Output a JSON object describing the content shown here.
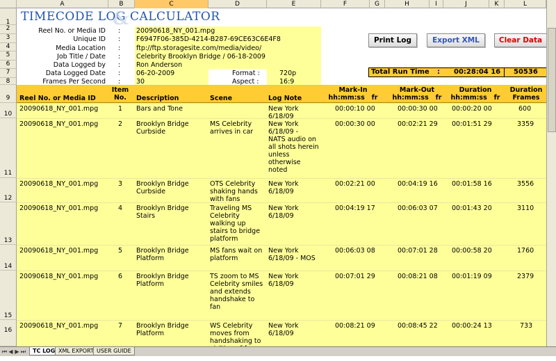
{
  "columns": [
    "A",
    "B",
    "C",
    "D",
    "E",
    "F",
    "G",
    "H",
    "I",
    "J",
    "K",
    "L"
  ],
  "selected_column": "C",
  "title": "TIMECODE LOG CALCULATOR",
  "title_glyph": "&",
  "meta": [
    {
      "label": "Reel No. or Media ID",
      "sep": ":",
      "value": "20090618_NY_001.mpg"
    },
    {
      "label": "Unique ID",
      "sep": ":",
      "value": "F6947F06-385D-4214-B287-69CE63C6E4F8"
    },
    {
      "label": "Media Location",
      "sep": ":",
      "value": "ftp://ftp.storagesite.com/media/video/"
    },
    {
      "label": "Job Title / Date",
      "sep": ":",
      "value": "Celebrity Brooklyn Bridge / 06-18-2009"
    },
    {
      "label": "Data Logged by",
      "sep": ":",
      "value": "Ron Anderson"
    },
    {
      "label": "Data Logged Date",
      "sep": ":",
      "value": "06-20-2009"
    },
    {
      "label": "Frames Per Second",
      "sep": ":",
      "value": "30"
    }
  ],
  "format_label": "Format :",
  "format_value": "720p",
  "aspect_label": "Aspect :",
  "aspect_value": "16:9",
  "buttons": {
    "print": "Print Log",
    "export": "Export XML",
    "clear": "Clear Data"
  },
  "total": {
    "label": "Total Run Time",
    "sep": ":",
    "time": "00:28:04 16",
    "frames": "50536"
  },
  "headers": {
    "reel": "Reel No. or Media ID",
    "item": "Item\nNo.",
    "desc": "Description",
    "scene": "Scene",
    "note": "Log Note",
    "markin": "Mark-In\nhh:mm:ss   fr",
    "markout": "Mark-Out\nhh:mm:ss   fr",
    "duration": "Duration\nhh:mm:ss   fr",
    "durframes": "Duration\nFrames"
  },
  "row_numbers": [
    "1",
    "2",
    "3",
    "4",
    "5",
    "6",
    "7",
    "8",
    "9",
    "10",
    "11",
    "12",
    "13",
    "14",
    "15",
    "16"
  ],
  "rows": [
    {
      "reel": "20090618_NY_001.mpg",
      "item": "1",
      "desc": "Bars and Tone",
      "scene": "",
      "note": "New York\n6/18/09",
      "in": "00:00:10 00",
      "out": "00:00:30 00",
      "dur": "00:00:20 00",
      "frames": "600"
    },
    {
      "reel": "20090618_NY_001.mpg",
      "item": "2",
      "desc": "Brooklyn Bridge\nCurbside",
      "scene": "MS Celebrity\narrives in car",
      "note": "New York\n6/18/09 -\nNATS audio on\nall shots herein\nunless\notherwise\nnoted",
      "in": "00:00:30 00",
      "out": "00:02:21 29",
      "dur": "00:01:51 29",
      "frames": "3359"
    },
    {
      "reel": "20090618_NY_001.mpg",
      "item": "3",
      "desc": "Brooklyn Bridge\nCurbside",
      "scene": "OTS Celebrity\nshaking hands\nwith fans",
      "note": "New York\n6/18/09",
      "in": "00:02:21 00",
      "out": "00:04:19 16",
      "dur": "00:01:58 16",
      "frames": "3556"
    },
    {
      "reel": "20090618_NY_001.mpg",
      "item": "4",
      "desc": "Brooklyn Bridge\nStairs",
      "scene": "Traveling MS\nCelebrity\nwalking up\nstairs to bridge\nplatform",
      "note": "New York\n6/18/09",
      "in": "00:04:19 17",
      "out": "00:06:03 07",
      "dur": "00:01:43 20",
      "frames": "3110"
    },
    {
      "reel": "20090618_NY_001.mpg",
      "item": "5",
      "desc": "Brooklyn Bridge\nPlatform",
      "scene": "MS fans wait on\nplatform",
      "note": "New York\n6/18/09 - MOS",
      "in": "00:06:03 08",
      "out": "00:07:01 28",
      "dur": "00:00:58 20",
      "frames": "1760"
    },
    {
      "reel": "20090618_NY_001.mpg",
      "item": "6",
      "desc": "Brooklyn Bridge\nPlatform",
      "scene": "TS zoom to MS\nCelebrity smiles\nand extends\nhandshake to\nfan",
      "note": "New York\n6/18/09",
      "in": "00:07:01 29",
      "out": "00:08:21 08",
      "dur": "00:01:19 09",
      "frames": "2379"
    },
    {
      "reel": "20090618_NY_001.mpg",
      "item": "7",
      "desc": "Brooklyn Bridge\nPlatform",
      "scene": "WS Celebrity\nmoves from\nhandshaking to\nvisiting of fans",
      "note": "New York\n6/18/09",
      "in": "00:08:21 09",
      "out": "00:08:45 22",
      "dur": "00:00:24 13",
      "frames": "733"
    }
  ],
  "tabs": [
    "TC LOG",
    "XML EXPORT",
    "USER GUIDE"
  ],
  "active_tab": "TC LOG",
  "colors": {
    "yellow": "#ffff99",
    "orange": "#ffcc33",
    "title_blue": "#2255aa",
    "clear_red": "#dd0000",
    "export_blue": "#3355bb"
  }
}
